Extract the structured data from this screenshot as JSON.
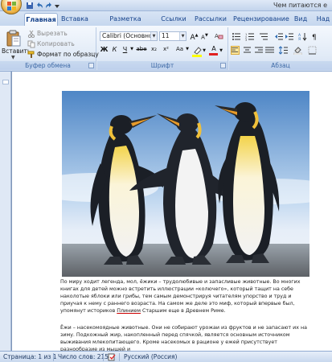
{
  "window": {
    "title": "Чем питаются е"
  },
  "tabs": [
    {
      "label": "Главная",
      "active": true
    },
    {
      "label": "Вставка"
    },
    {
      "label": "Разметка страницы"
    },
    {
      "label": "Ссылки"
    },
    {
      "label": "Рассылки"
    },
    {
      "label": "Рецензирование"
    },
    {
      "label": "Вид"
    },
    {
      "label": "Над"
    }
  ],
  "ribbon": {
    "clipboard": {
      "group_label": "Буфер обмена",
      "paste": "Вставить",
      "cut": "Вырезать",
      "copy": "Копировать",
      "format_painter": "Формат по образцу"
    },
    "font": {
      "group_label": "Шрифт",
      "font_name": "Calibri (Основной те",
      "font_size": "11",
      "bold": "Ж",
      "italic": "К",
      "underline": "Ч",
      "strike": "abe",
      "subscript": "x₂",
      "superscript": "x²",
      "change_case": "Aa",
      "grow": "A",
      "shrink": "A",
      "font_color": "A",
      "highlight_color": "#ffff00",
      "font_color_value": "#e02020"
    },
    "paragraph": {
      "group_label": "Абзац"
    }
  },
  "document": {
    "paragraph1_parts": [
      "По миру ходит легенда, мол, ёжики – трудолюбивые и запасливые животные. Во многих книгах для детей можно встретить иллюстрации «колючего», который тащит на себе наколотые яблоки или грибы, тем самым демонстрируя читателям упорство и труд и приучая к нему с раннего возраста. На самом же деле  это миф, который впервые был, упомянут историков ",
      "Плинием",
      " Старшим еще в Древнем Риме."
    ],
    "paragraph2": "Ёжи – насекомоядные животные. Они не собирают урожаи из фруктов и не запасают их на зиму. Подкожный жир, накопленный перед спячкой, является основным источником выживания млекопитающего. Кроме насекомых в рационе у ежей присутствует разнообразие из мышей и"
  },
  "status": {
    "page": "Страница: 1 из 1",
    "words": "Число слов: 215",
    "language": "Русский (Россия)"
  },
  "colors": {
    "accent": "#15428b",
    "ribbon_bg": "#dbe6f4"
  }
}
